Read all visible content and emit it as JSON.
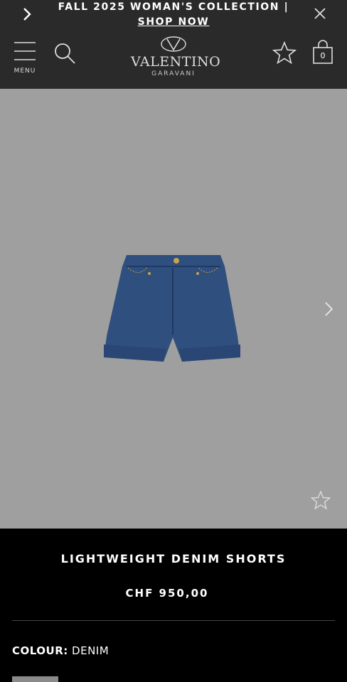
{
  "promo": {
    "text": "FALL 2025 WOMAN'S COLLECTION | ",
    "link": "SHOP NOW"
  },
  "header": {
    "menu_label": "MENU",
    "brand": "VALENTINO",
    "sub_brand": "GARAVANI",
    "bag_count": "0"
  },
  "product": {
    "name": "LIGHTWEIGHT DENIM SHORTS",
    "price": "CHF 950,00",
    "colour_label": "COLOUR:",
    "colour_value": "DENIM"
  },
  "colors": {
    "header_bg": "#2a2a2a",
    "gallery_bg": "#9f9f9f",
    "denim": "#2f4f7e"
  }
}
